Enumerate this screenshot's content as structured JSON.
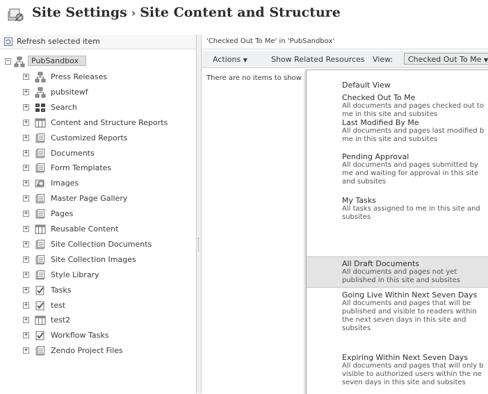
{
  "header": {
    "crumb_root": "Site Settings",
    "separator": "›",
    "crumb_current": "Site Content and Structure",
    "icon": "site-settings-icon"
  },
  "tree": {
    "refresh_label": "Refresh selected item",
    "root_label": "PubSandbox",
    "items": [
      {
        "label": "Press Releases",
        "icon": "subsite-icon"
      },
      {
        "label": "pubsitewf",
        "icon": "subsite-icon"
      },
      {
        "label": "Search",
        "icon": "search-site-icon"
      },
      {
        "label": "Content and Structure Reports",
        "icon": "list-icon"
      },
      {
        "label": "Customized Reports",
        "icon": "library-icon"
      },
      {
        "label": "Documents",
        "icon": "library-icon"
      },
      {
        "label": "Form Templates",
        "icon": "library-icon"
      },
      {
        "label": "Images",
        "icon": "image-library-icon"
      },
      {
        "label": "Master Page Gallery",
        "icon": "library-icon"
      },
      {
        "label": "Pages",
        "icon": "library-icon"
      },
      {
        "label": "Reusable Content",
        "icon": "list-icon"
      },
      {
        "label": "Site Collection Documents",
        "icon": "library-icon"
      },
      {
        "label": "Site Collection Images",
        "icon": "library-icon"
      },
      {
        "label": "Style Library",
        "icon": "library-icon"
      },
      {
        "label": "Tasks",
        "icon": "tasks-icon"
      },
      {
        "label": "test",
        "icon": "tasks-icon"
      },
      {
        "label": "test2",
        "icon": "list-icon"
      },
      {
        "label": "Workflow Tasks",
        "icon": "tasks-icon"
      },
      {
        "label": "Zendo Project Files",
        "icon": "library-icon"
      }
    ]
  },
  "content": {
    "caption": "'Checked Out To Me' in 'PubSandbox'",
    "actions_label": "Actions",
    "related_label": "Show Related Resources",
    "view_label": "View:",
    "view_value": "Checked Out To Me",
    "empty_message": "There are no items to show"
  },
  "view_menu": {
    "items": [
      {
        "title": "Default View",
        "desc": []
      },
      {
        "title": "Checked Out To Me",
        "desc": [
          "All documents and pages checked out to",
          "me in this site and subsites"
        ]
      },
      {
        "title": "Last Modified By Me",
        "desc": [
          "All documents and pages last modified b",
          "me in this site and subsites"
        ]
      },
      {
        "title": "Pending Approval",
        "desc": [
          "All documents and pages submitted by",
          "me and waiting for approval in this site",
          "and subsites"
        ]
      },
      {
        "title": "My Tasks",
        "desc": [
          "All tasks assigned to me in this site and",
          "subsites"
        ]
      },
      {
        "title": "All Draft Documents",
        "desc": [
          "All documents and pages not yet",
          "published in this site and subsites"
        ]
      },
      {
        "title": "Going Live Within Next Seven Days",
        "desc": [
          "All documents and pages that will be",
          "published and visible to readers within",
          "the next seven days in this site and",
          "subsites"
        ]
      },
      {
        "title": "Expiring Within Next Seven Days",
        "desc": [
          "All documents and pages that will only b",
          "visible to authorized users within the ne",
          "seven days in this site and subsites"
        ]
      }
    ]
  },
  "colors": {
    "highlight": "#e4e4e4",
    "toolbar_bg": "#eef0f2",
    "root_selected": "#dedede"
  }
}
